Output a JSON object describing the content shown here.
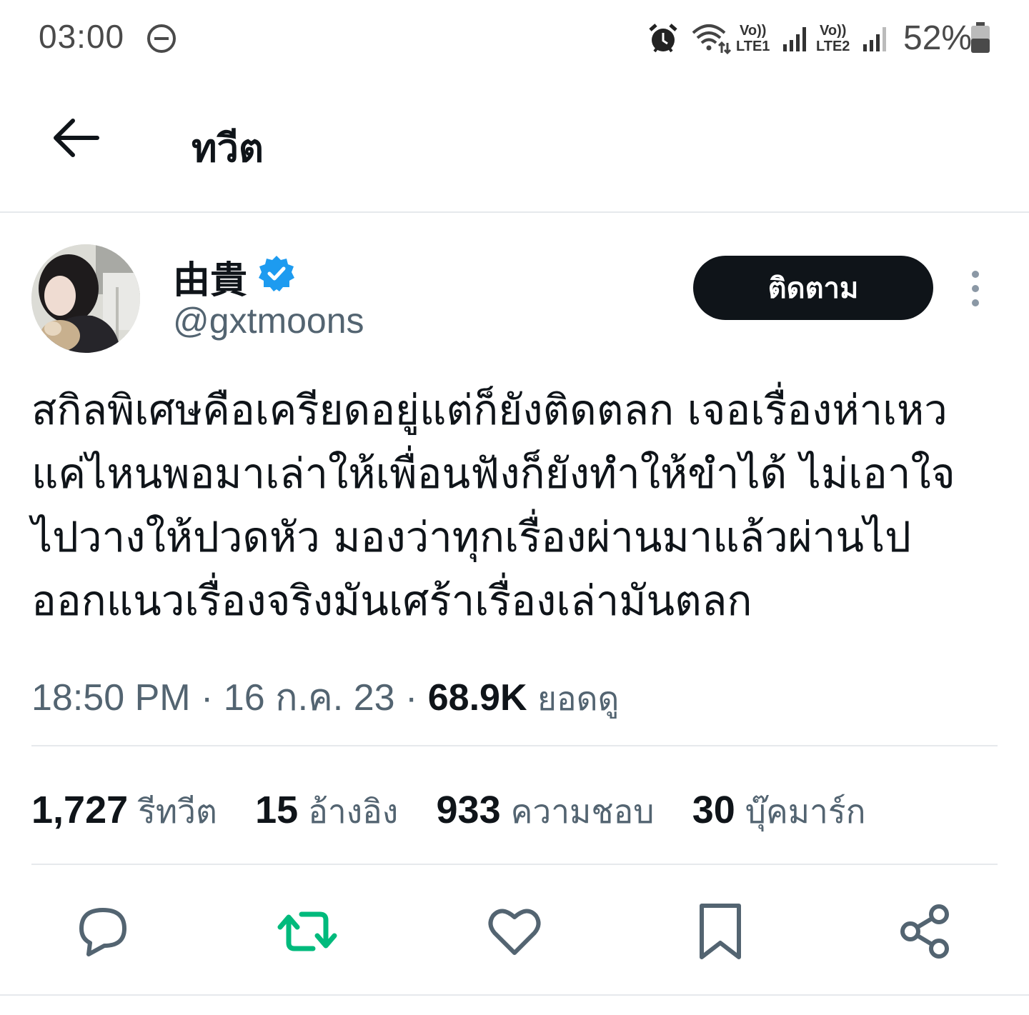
{
  "status_bar": {
    "time": "03:00",
    "volte1": "Vo))\nLTE1",
    "volte1_top": "Vo))",
    "volte1_bottom": "LTE1",
    "volte2_top": "Vo))",
    "volte2_bottom": "LTE2",
    "battery": "52%"
  },
  "header": {
    "title": "ทวีต"
  },
  "author": {
    "display_name": "由貴",
    "handle": "@gxtmoons",
    "verified": true,
    "follow_label": "ติดตาม"
  },
  "tweet": {
    "lines": [
      "สกิลพิเศษคือเครียดอยู่แต่ก็ยังติดตลก เจอเรื่องห่าเหว",
      "แค่ไหนพอมาเล่าให้เพื่อนฟังก็ยังทำให้ขำได้ ไม่เอาใจ",
      "ไปวางให้ปวดหัว มองว่าทุกเรื่องผ่านมาแล้วผ่านไป",
      "ออกแนวเรื่องจริงมันเศร้าเรื่องเล่ามันตลก"
    ],
    "time": "18:50 PM",
    "date": "16 ก.ค. 23",
    "views_count": "68.9K",
    "views_label": "ยอดดู"
  },
  "stats": {
    "retweets_count": "1,727",
    "retweets_label": "รีทวีต",
    "quotes_count": "15",
    "quotes_label": "อ้างอิง",
    "likes_count": "933",
    "likes_label": "ความชอบ",
    "bookmarks_count": "30",
    "bookmarks_label": "บุ๊คมาร์ก"
  },
  "colors": {
    "text_primary": "#0f1419",
    "text_secondary": "#536471",
    "verified_blue": "#1d9bf0",
    "retweet_green": "#00ba7c",
    "divider": "#e6e9ec"
  },
  "icons": [
    "dnd-icon",
    "alarm-icon",
    "wifi-icon",
    "signal-icon",
    "battery-icon",
    "back-arrow-icon",
    "verified-badge-icon",
    "more-vertical-icon",
    "reply-icon",
    "retweet-icon",
    "like-icon",
    "bookmark-icon",
    "share-icon"
  ]
}
